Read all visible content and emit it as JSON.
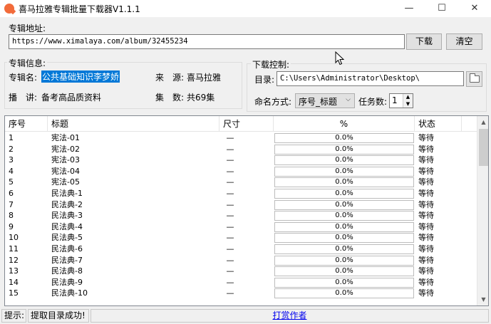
{
  "window": {
    "title": "喜马拉雅专辑批量下载器V1.1.1",
    "min_glyph": "—",
    "max_glyph": "☐",
    "close_glyph": "✕"
  },
  "album": {
    "label": "专辑地址:",
    "url": "https://www.ximalaya.com/album/32455234",
    "download_label": "下载",
    "clear_label": "清空"
  },
  "info": {
    "group_label": "专辑信息:",
    "name_key": "专辑名:",
    "name_value": "公共基础知识李梦娇",
    "source_key": "来　源:",
    "source_value": "喜马拉雅",
    "host_key": "播　讲:",
    "host_value": "备考高品质资料",
    "episodes_key": "集　数:",
    "episodes_value": "共69集"
  },
  "control": {
    "group_label": "下载控制:",
    "dir_label": "目录:",
    "dir_value": "C:\\Users\\Administrator\\Desktop\\",
    "naming_label": "命名方式:",
    "naming_value": "序号_标题",
    "tasks_label": "任务数:",
    "tasks_value": "1"
  },
  "list": {
    "columns": [
      "序号",
      "标题",
      "尺寸",
      "%",
      "状态"
    ],
    "rows": [
      {
        "num": "1",
        "title": "宪法-01",
        "size": "—",
        "progress": "0.0%",
        "state": "等待"
      },
      {
        "num": "2",
        "title": "宪法-02",
        "size": "—",
        "progress": "0.0%",
        "state": "等待"
      },
      {
        "num": "3",
        "title": "宪法-03",
        "size": "—",
        "progress": "0.0%",
        "state": "等待"
      },
      {
        "num": "4",
        "title": "宪法-04",
        "size": "—",
        "progress": "0.0%",
        "state": "等待"
      },
      {
        "num": "5",
        "title": "宪法-05",
        "size": "—",
        "progress": "0.0%",
        "state": "等待"
      },
      {
        "num": "6",
        "title": "民法典-1",
        "size": "—",
        "progress": "0.0%",
        "state": "等待"
      },
      {
        "num": "7",
        "title": "民法典-2",
        "size": "—",
        "progress": "0.0%",
        "state": "等待"
      },
      {
        "num": "8",
        "title": "民法典-3",
        "size": "—",
        "progress": "0.0%",
        "state": "等待"
      },
      {
        "num": "9",
        "title": "民法典-4",
        "size": "—",
        "progress": "0.0%",
        "state": "等待"
      },
      {
        "num": "10",
        "title": "民法典-5",
        "size": "—",
        "progress": "0.0%",
        "state": "等待"
      },
      {
        "num": "11",
        "title": "民法典-6",
        "size": "—",
        "progress": "0.0%",
        "state": "等待"
      },
      {
        "num": "12",
        "title": "民法典-7",
        "size": "—",
        "progress": "0.0%",
        "state": "等待"
      },
      {
        "num": "13",
        "title": "民法典-8",
        "size": "—",
        "progress": "0.0%",
        "state": "等待"
      },
      {
        "num": "14",
        "title": "民法典-9",
        "size": "—",
        "progress": "0.0%",
        "state": "等待"
      },
      {
        "num": "15",
        "title": "民法典-10",
        "size": "—",
        "progress": "0.0%",
        "state": "等待"
      }
    ]
  },
  "status": {
    "hint_label": "提示:",
    "message": "提取目录成功!",
    "link": "打赏作者"
  },
  "colors": {
    "selection": "#0078d7",
    "link": "#0000ee",
    "app_icon": "#f26b3a"
  }
}
